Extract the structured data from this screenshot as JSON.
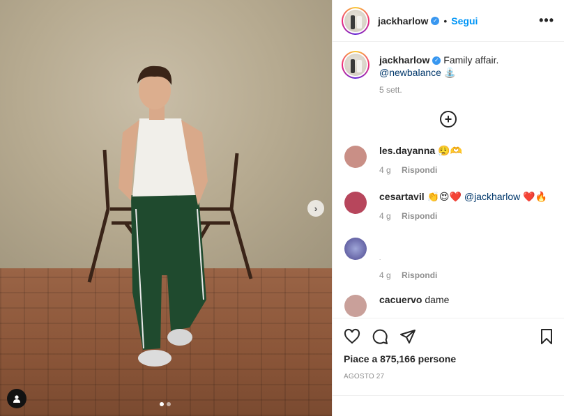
{
  "post": {
    "username": "jackharlow",
    "verified_mark": "✓",
    "separator": "•",
    "follow_label": "Segui",
    "more_label": "•••",
    "carousel_next": "›"
  },
  "caption": {
    "username": "jackharlow",
    "text": "Family affair.",
    "mention": "@newbalance",
    "emoji": "⛲",
    "time": "5 sett."
  },
  "load_more_label": "+",
  "comments": [
    {
      "username": "les.dayanna",
      "text": "😮‍💨🫶",
      "time": "4 g",
      "reply": "Rispondi",
      "avatar_color": "#c98f86"
    },
    {
      "username": "cesartavil",
      "text": "👏😍❤️",
      "mention": "@jackharlow",
      "text_after": "❤️🔥",
      "time": "4 g",
      "reply": "Rispondi",
      "avatar_color": "#b7465c"
    },
    {
      "username": "",
      "text": ".",
      "time": "4 g",
      "reply": "Rispondi",
      "avatar_color": "#6f6aa8"
    },
    {
      "username": "cacuervo",
      "text": "dame",
      "avatar_color": "#c9a09a"
    }
  ],
  "likes_text": "Piace a 875,166 persone",
  "date_text": "AGOSTO 27",
  "icons": [
    "heart-icon",
    "comment-icon",
    "share-icon",
    "bookmark-icon",
    "user-tag-icon",
    "chevron-right-icon",
    "add-circle-icon"
  ],
  "colors": {
    "accent": "#0095f6",
    "mention": "#00376b",
    "muted": "#8e8e8e"
  }
}
